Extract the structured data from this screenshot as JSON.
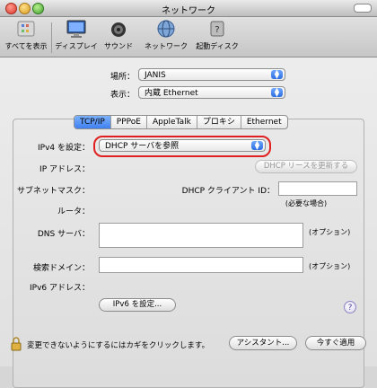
{
  "window": {
    "title": "ネットワーク"
  },
  "toolbar": {
    "items": [
      {
        "label": "すべてを表示",
        "icon": "show-all-icon"
      },
      {
        "label": "ディスプレイ",
        "icon": "display-icon"
      },
      {
        "label": "サウンド",
        "icon": "sound-icon"
      },
      {
        "label": "ネットワーク",
        "icon": "network-icon"
      },
      {
        "label": "起動ディスク",
        "icon": "startup-disk-icon"
      }
    ]
  },
  "location": {
    "label": "場所：",
    "value": "JANIS"
  },
  "show": {
    "label": "表示：",
    "value": "内蔵 Ethernet"
  },
  "tabs": [
    "TCP/IP",
    "PPPoE",
    "AppleTalk",
    "プロキシ",
    "Ethernet"
  ],
  "tcpip": {
    "ipv4_label": "IPv4 を設定：",
    "ipv4_value": "DHCP サーバを参照",
    "ip_label": "IP アドレス：",
    "renew_button": "DHCP リースを更新する",
    "subnet_label": "サブネットマスク：",
    "client_id_label": "DHCP クライアント ID：",
    "client_id_note": "(必要な場合)",
    "router_label": "ルータ：",
    "dns_label": "DNS サーバ：",
    "dns_note": "(オプション)",
    "search_label": "検索ドメイン：",
    "search_note": "(オプション)",
    "ipv6_label": "IPv6 アドレス：",
    "ipv6_button": "IPv6 を設定...",
    "help_glyph": "?"
  },
  "footer": {
    "lock_text": "変更できないようにするにはカギをクリックします。",
    "assistant_button": "アシスタント...",
    "apply_button": "今すぐ適用"
  },
  "colors": {
    "accent": "#3f7ff0",
    "highlight": "#e02020"
  }
}
